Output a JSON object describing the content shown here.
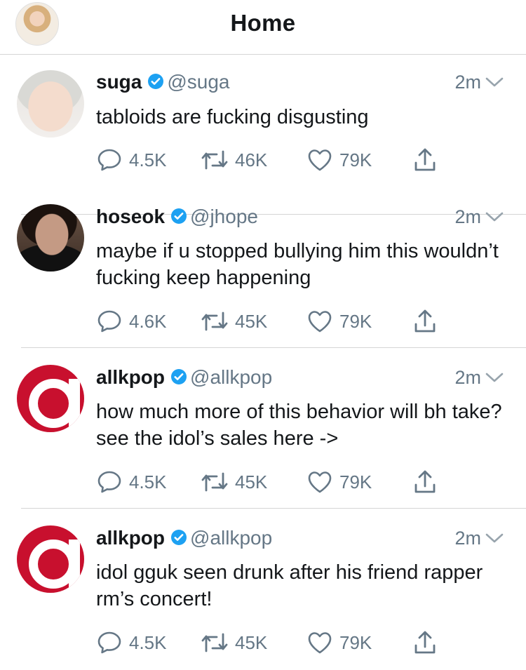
{
  "header": {
    "title": "Home"
  },
  "colors": {
    "accent": "#1da1f2",
    "secondary_text": "#657786",
    "divider": "#d5d5d5",
    "allkpop_red": "#c8102e"
  },
  "tweets": [
    {
      "avatar_icon": "suga-avatar",
      "name": "suga",
      "handle": "@suga",
      "time": "2m",
      "text": "tabloids are fucking disgusting",
      "replies": "4.5K",
      "retweets": "46K",
      "likes": "79K"
    },
    {
      "avatar_icon": "hoseok-avatar",
      "name": "hoseok",
      "handle": "@jhope",
      "time": "2m",
      "text": "maybe if u stopped bullying him this wouldn’t fucking keep happening",
      "replies": "4.6K",
      "retweets": "45K",
      "likes": "79K"
    },
    {
      "avatar_icon": "allkpop-logo",
      "name": "allkpop",
      "handle": "@allkpop",
      "time": "2m",
      "text": "how much more of this behavior will bh take? see the idol’s sales here ->",
      "replies": "4.5K",
      "retweets": "45K",
      "likes": "79K"
    },
    {
      "avatar_icon": "allkpop-logo",
      "name": "allkpop",
      "handle": "@allkpop",
      "time": "2m",
      "text": "idol gguk seen drunk after his friend rapper rm’s concert!",
      "replies": "4.5K",
      "retweets": "45K",
      "likes": "79K"
    }
  ]
}
